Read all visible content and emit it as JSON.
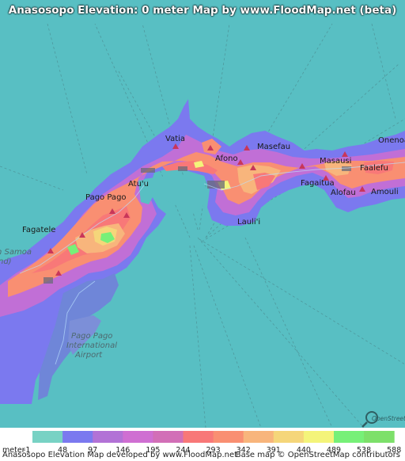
{
  "title": "Anasosopo Elevation: 0 meter Map by www.FloodMap.net (beta)",
  "colors": {
    "water": "#58bfc3",
    "accent_text": "#ffffff"
  },
  "places": [
    {
      "name": "Vatia",
      "style": "normal"
    },
    {
      "name": "Masefau",
      "style": "normal"
    },
    {
      "name": "Onenoa",
      "style": "normal"
    },
    {
      "name": "Afono",
      "style": "normal"
    },
    {
      "name": "Masausi",
      "style": "normal"
    },
    {
      "name": "Faalefu",
      "style": "normal"
    },
    {
      "name": "Atu'u",
      "style": "normal"
    },
    {
      "name": "Pago Pago",
      "style": "normal"
    },
    {
      "name": "Fagaitua",
      "style": "normal"
    },
    {
      "name": "Alofau",
      "style": "normal"
    },
    {
      "name": "Amouli",
      "style": "normal"
    },
    {
      "name": "Lauli'i",
      "style": "normal"
    },
    {
      "name": "Fagatele",
      "style": "normal"
    },
    {
      "name": "Pago Pago",
      "style": "dim"
    },
    {
      "name": "International",
      "style": "dim"
    },
    {
      "name": "Airport",
      "style": "dim"
    }
  ],
  "partial_label": "n Samoa",
  "partial_label2": "nd)",
  "watermark": "OpenStreetMap",
  "legend": {
    "unit_label": "meter",
    "ticks": [
      "-1",
      "48",
      "97",
      "146",
      "195",
      "244",
      "293",
      "342",
      "391",
      "440",
      "489",
      "538",
      "588"
    ],
    "colors": [
      "#78d2c4",
      "#7b79ef",
      "#b272d6",
      "#cf6fd2",
      "#d26fb7",
      "#f87878",
      "#f98f72",
      "#f8b57c",
      "#f5d67a",
      "#f4f47a",
      "#77f078",
      "#7de06a"
    ]
  },
  "credits": {
    "left": "Anasosopo Elevation Map developed by www.FloodMap.net",
    "right": "Base map © OpenStreetMap contributors"
  }
}
